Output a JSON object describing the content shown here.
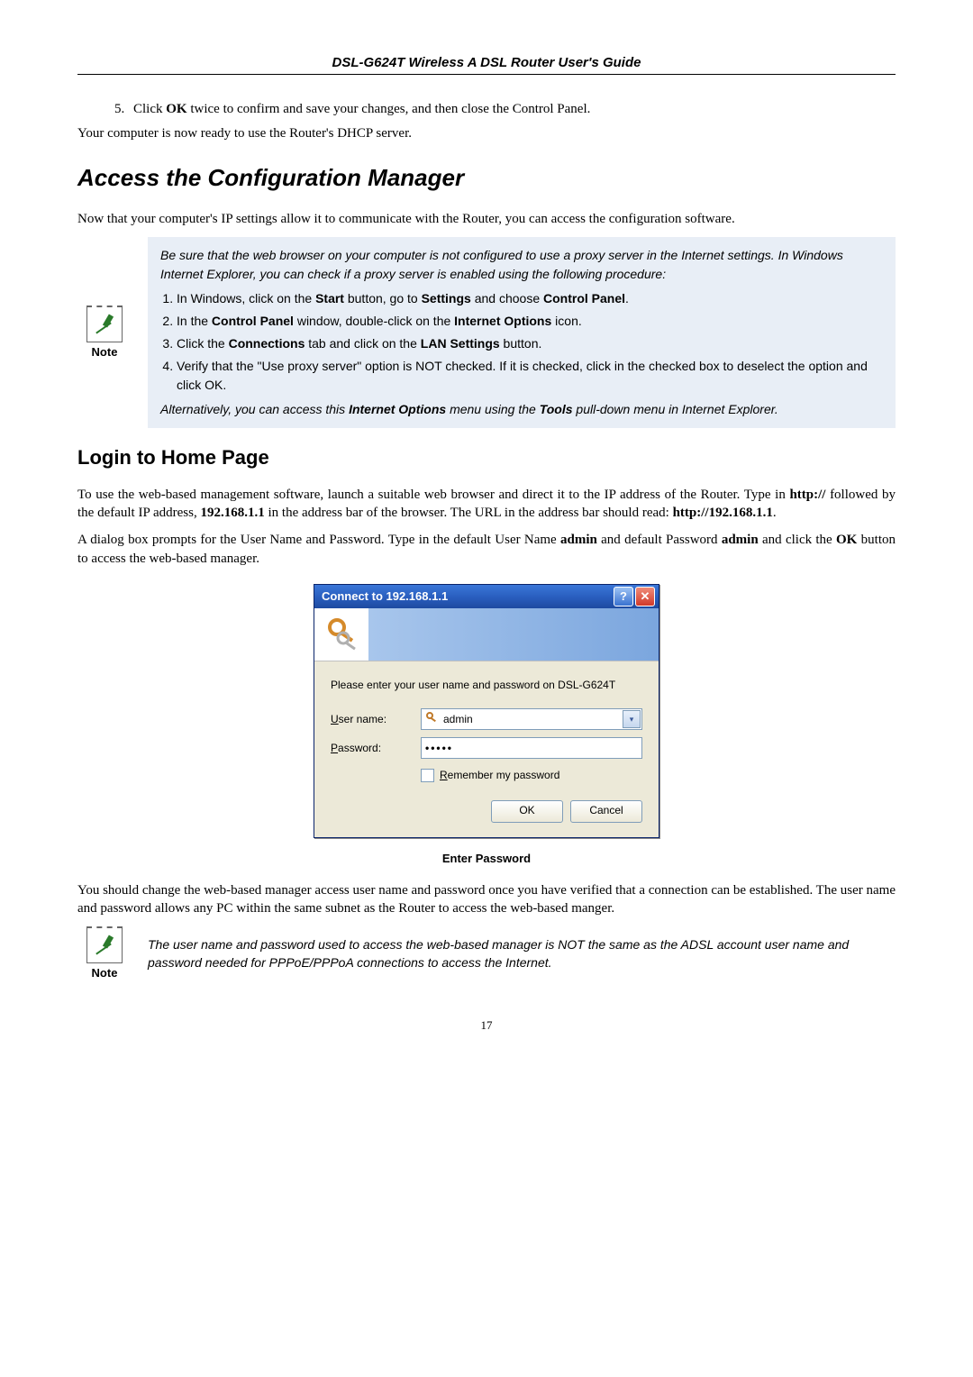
{
  "header": {
    "title": "DSL-G624T Wireless A DSL Router User's Guide"
  },
  "step5": {
    "pre": "Click ",
    "bold": "OK",
    "post": " twice to confirm and save your changes, and then close the Control Panel."
  },
  "afterStep": "Your computer is now ready to use the Router's DHCP server.",
  "h1": "Access the Configuration  Manager",
  "intro1": "Now that your computer's IP settings allow it to communicate with the Router, you can access the configuration software.",
  "noteLabel": "Note",
  "note1": {
    "ital1": "Be sure that the web browser on your computer is not configured to use a proxy server in the Internet settings. In Windows Internet Explorer, you can check if a proxy server is enabled using the following procedure:",
    "li1a": "In Windows, click on the ",
    "li1b": "Start",
    "li1c": " button, go to ",
    "li1d": "Settings",
    "li1e": " and choose ",
    "li1f": "Control Panel",
    "li1g": ".",
    "li2a": "In the ",
    "li2b": "Control Panel",
    "li2c": " window, double-click on the ",
    "li2d": "Internet Options",
    "li2e": " icon.",
    "li3a": "Click the ",
    "li3b": "Connections",
    "li3c": " tab and click on the ",
    "li3d": "LAN Settings",
    "li3e": " button.",
    "li4": "Verify that the \"Use proxy server\" option is NOT checked. If it is checked, click in the checked box to deselect the option and click OK.",
    "ital2a": "Alternatively, you can access this ",
    "ital2b": "Internet Options",
    "ital2c": " menu using the ",
    "ital2d": "Tools",
    "ital2e": " pull-down menu in Internet Explorer."
  },
  "h2": "Login to Home Page",
  "para2a": "To use the web-based management software, launch a suitable web browser and direct it to the IP address of the Router. Type in ",
  "para2b": "http://",
  "para2c": " followed by the default IP address, ",
  "para2d": "192.168.1.1",
  "para2e": " in the address bar of the browser. The URL in the address bar should read: ",
  "para2f": "http://192.168.1.1",
  "para2g": ".",
  "para3a": "A dialog box prompts for the User Name and Password. Type in the default User Name ",
  "para3b": "admin",
  "para3c": " and default Password ",
  "para3d": "admin",
  "para3e": " and click the ",
  "para3f": "OK",
  "para3g": " button to access the web-based manager.",
  "dialog": {
    "title": "Connect to 192.168.1.1",
    "helpGlyph": "?",
    "closeGlyph": "✕",
    "prompt": "Please enter your user name and password on DSL-G624T",
    "userLabelPre": "U",
    "userLabelPost": "ser name:",
    "userValue": "admin",
    "passLabelPre": "P",
    "passLabelPost": "assword:",
    "passValue": "•••••",
    "rememberPre": "R",
    "rememberPost": "emember my password",
    "ok": "OK",
    "cancel": "Cancel"
  },
  "figureCaption": "Enter Password",
  "para4": "You should change the web-based manager access user name and password once you have verified that a connection can be established. The user name and password allows any PC within the same subnet as the Router to access the web-based manger.",
  "note2": "The user name and password used to access the web-based manager is NOT the same as the ADSL account user name and password needed for PPPoE/PPPoA connections to access the Internet.",
  "pageNumber": "17"
}
